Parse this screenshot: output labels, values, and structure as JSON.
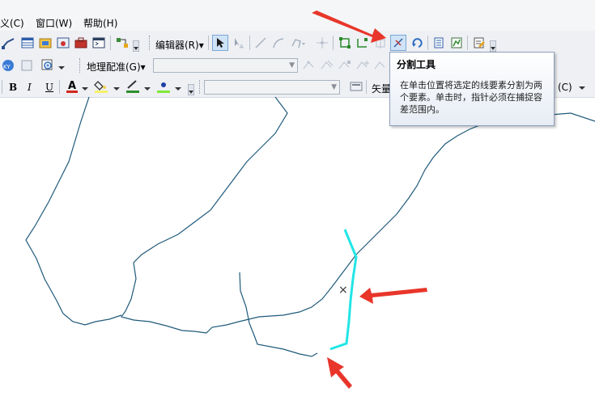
{
  "menubar": {
    "items": [
      {
        "label": "义(C)"
      },
      {
        "label": "窗口(W)"
      },
      {
        "label": "帮助(H)"
      }
    ]
  },
  "toolbar1": {
    "editor_label": "编辑器(R)",
    "editor_dropdown": "▾"
  },
  "toolbar2": {
    "georef_label": "地理配准(G)",
    "georef_dropdown": "▾",
    "georef_layer_value": ""
  },
  "toolbar3": {
    "bold": "B",
    "italic": "I",
    "underline": "U",
    "font_color_letter": "A",
    "vector_label": "矢量",
    "right_label": "(C)"
  },
  "tooltip": {
    "title": "分割工具",
    "body": "在单击位置将选定的线要素分割为两个要素。单击时，指针必须在捕捉容差范围内。"
  },
  "map": {
    "cursor_glyph": "×",
    "colors": {
      "line": "#1f5a7a",
      "selected_line": "#22e5e5",
      "annotation_arrow": "#e8362a"
    }
  }
}
